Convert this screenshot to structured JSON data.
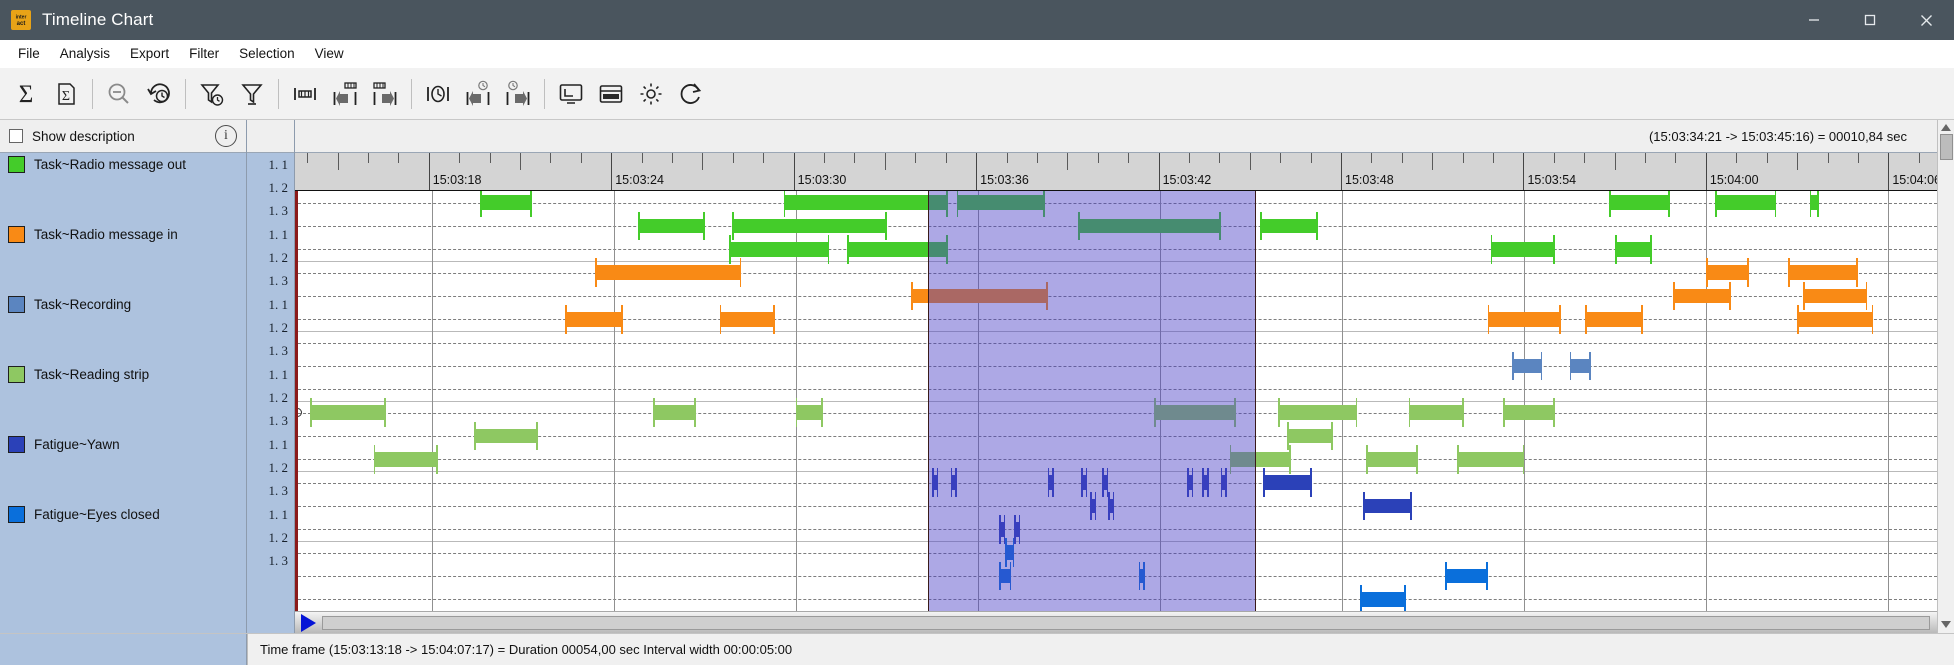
{
  "window": {
    "title": "Timeline Chart",
    "app_icon": "interact-logo-icon",
    "minimize_label": "—",
    "maximize_label": "□",
    "close_label": "✕"
  },
  "menubar": {
    "items": [
      {
        "label": "File",
        "name": "menu-file"
      },
      {
        "label": "Analysis",
        "name": "menu-analysis"
      },
      {
        "label": "Export",
        "name": "menu-export"
      },
      {
        "label": "Filter",
        "name": "menu-filter"
      },
      {
        "label": "Selection",
        "name": "menu-selection"
      },
      {
        "label": "View",
        "name": "menu-view"
      }
    ]
  },
  "toolbar": {
    "buttons": [
      {
        "name": "sum-button",
        "icon": "sigma-icon"
      },
      {
        "name": "sum-document-button",
        "icon": "sigma-document-icon"
      },
      {
        "name": "zoom-out-button",
        "icon": "magnifier-minus-icon"
      },
      {
        "name": "reset-zoom-history-button",
        "icon": "clock-undo-icon"
      },
      {
        "name": "filter-time-button",
        "icon": "funnel-clock-icon"
      },
      {
        "name": "filter-button",
        "icon": "funnel-icon"
      },
      {
        "name": "interval-width-button",
        "icon": "interval-span-icon"
      },
      {
        "name": "step-interval-back-button",
        "icon": "interval-step-left-icon"
      },
      {
        "name": "step-interval-forward-button",
        "icon": "interval-step-right-icon"
      },
      {
        "name": "time-span-button",
        "icon": "clock-span-icon"
      },
      {
        "name": "step-time-back-button",
        "icon": "clock-step-left-icon"
      },
      {
        "name": "step-time-forward-button",
        "icon": "clock-step-right-icon"
      },
      {
        "name": "fit-window-button",
        "icon": "screen-fit-icon"
      },
      {
        "name": "layout-rows-button",
        "icon": "rows-layout-icon"
      },
      {
        "name": "settings-button",
        "icon": "gear-icon"
      },
      {
        "name": "refresh-button",
        "icon": "refresh-icon"
      }
    ]
  },
  "sidebar": {
    "show_description_label": "Show description",
    "show_description_checked": false,
    "info_icon": "info-icon",
    "info_glyph": "i",
    "tracks": [
      {
        "label": "Task~Radio message out",
        "color": "#44cc2a",
        "name": "legend-task-radio-message-out"
      },
      {
        "label": "Task~Radio message in",
        "color": "#f98a15",
        "name": "legend-task-radio-message-in"
      },
      {
        "label": "Task~Recording",
        "color": "#5b85c0",
        "name": "legend-task-recording"
      },
      {
        "label": "Task~Reading strip",
        "color": "#8ec862",
        "name": "legend-task-reading-strip"
      },
      {
        "label": "Fatigue~Yawn",
        "color": "#2b41b8",
        "name": "legend-fatigue-yawn"
      },
      {
        "label": "Fatigue~Eyes closed",
        "color": "#0a6fdb",
        "name": "legend-fatigue-eyes-closed"
      }
    ],
    "row_numbers": [
      "1.  1",
      "1.  2",
      "1.  3",
      "1.  1",
      "1.  2",
      "1.  3",
      "1.  1",
      "1.  2",
      "1.  3",
      "1.  1",
      "1.  2",
      "1.  3",
      "1.  1",
      "1.  2",
      "1.  3",
      "1.  1",
      "1.  2",
      "1.  3"
    ]
  },
  "selection_info": {
    "text": "(15:03:34:21 -> 15:03:45:16) = 00010,84 sec"
  },
  "statusbar": {
    "text": "Time frame  (15:03:13:18 -> 15:04:07:17) = Duration 00054,00 sec   Interval width 00:00:05:00"
  },
  "scroll": {
    "play_icon": "play-triangle-icon",
    "up_arrow_icon": "scroll-up-arrow-icon",
    "down_arrow_icon": "scroll-down-arrow-icon"
  },
  "chart_data": {
    "type": "timeline",
    "title": "Timeline Chart",
    "xlabel": "",
    "ylabel": "",
    "time_start": "15:03:13:18",
    "time_end": "15:04:07:17",
    "duration_sec": 54.0,
    "interval_width": "00:00:05:00",
    "axis": {
      "t_min_sec": 13.6,
      "t_max_sec": 67.6,
      "tick_labels": [
        "15:03:18",
        "15:03:24",
        "15:03:30",
        "15:03:36",
        "15:03:42",
        "15:03:48",
        "15:03:54",
        "15:04:00",
        "15:04:06"
      ],
      "tick_seconds": [
        18,
        24,
        30,
        36,
        42,
        48,
        54,
        60,
        66
      ],
      "minor_tick_step_sec": 1,
      "grid": true
    },
    "selection": {
      "start_sec": 34.35,
      "end_sec": 45.16,
      "label": "(15:03:34:21 -> 15:03:45:16) = 00010,84 sec"
    },
    "marker_sec": 13.9,
    "tracks": [
      {
        "name": "Task~Radio message out",
        "color": "#44cc2a",
        "rows": [
          {
            "row": "1.  1",
            "bars": [
              {
                "start": 19.6,
                "end": 21.3
              },
              {
                "start": 29.6,
                "end": 35.0
              },
              {
                "start": 35.3,
                "end": 38.2
              },
              {
                "start": 56.8,
                "end": 58.8
              },
              {
                "start": 60.3,
                "end": 62.3
              },
              {
                "start": 63.4,
                "end": 63.7
              }
            ]
          },
          {
            "row": "1.  2",
            "bars": [
              {
                "start": 24.8,
                "end": 27.0
              },
              {
                "start": 27.9,
                "end": 33.0
              },
              {
                "start": 39.3,
                "end": 44.0
              },
              {
                "start": 45.3,
                "end": 47.2
              }
            ]
          },
          {
            "row": "1.  3",
            "bars": [
              {
                "start": 27.8,
                "end": 31.1
              },
              {
                "start": 31.7,
                "end": 35.0
              },
              {
                "start": 52.9,
                "end": 55.0
              },
              {
                "start": 57.0,
                "end": 58.2
              }
            ]
          }
        ]
      },
      {
        "name": "Task~Radio message in",
        "color": "#f98a15",
        "rows": [
          {
            "row": "1.  1",
            "bars": [
              {
                "start": 23.4,
                "end": 28.2
              },
              {
                "start": 60.0,
                "end": 61.4
              },
              {
                "start": 62.7,
                "end": 65.0
              }
            ]
          },
          {
            "row": "1.  2",
            "bars": [
              {
                "start": 33.8,
                "end": 38.3
              },
              {
                "start": 58.9,
                "end": 60.8
              },
              {
                "start": 63.2,
                "end": 65.3
              }
            ]
          },
          {
            "row": "1.  3",
            "bars": [
              {
                "start": 22.4,
                "end": 24.3
              },
              {
                "start": 27.5,
                "end": 29.3
              },
              {
                "start": 52.8,
                "end": 55.2
              },
              {
                "start": 56.0,
                "end": 57.9
              },
              {
                "start": 63.0,
                "end": 65.5
              }
            ]
          }
        ]
      },
      {
        "name": "Task~Recording",
        "color": "#5b85c0",
        "rows": [
          {
            "row": "1.  1",
            "bars": []
          },
          {
            "row": "1.  2",
            "bars": [
              {
                "start": 53.6,
                "end": 54.6
              },
              {
                "start": 55.5,
                "end": 56.2
              }
            ]
          },
          {
            "row": "1.  3",
            "bars": []
          }
        ]
      },
      {
        "name": "Task~Reading strip",
        "color": "#8ec862",
        "rows": [
          {
            "row": "1.  1",
            "bars": [
              {
                "start": 14.0,
                "end": 16.5
              },
              {
                "start": 25.3,
                "end": 26.7
              },
              {
                "start": 30.0,
                "end": 30.9
              },
              {
                "start": 41.8,
                "end": 44.5
              },
              {
                "start": 45.9,
                "end": 48.5
              },
              {
                "start": 50.2,
                "end": 52.0
              },
              {
                "start": 53.3,
                "end": 55.0
              }
            ]
          },
          {
            "row": "1.  2",
            "bars": [
              {
                "start": 19.4,
                "end": 21.5
              },
              {
                "start": 46.2,
                "end": 47.7
              }
            ]
          },
          {
            "row": "1.  3",
            "bars": [
              {
                "start": 16.1,
                "end": 18.2
              },
              {
                "start": 44.3,
                "end": 46.3
              },
              {
                "start": 48.8,
                "end": 50.5
              },
              {
                "start": 51.8,
                "end": 54.0
              }
            ]
          }
        ]
      },
      {
        "name": "Fatigue~Yawn",
        "color": "#2b41b8",
        "rows": [
          {
            "row": "1.  1",
            "bars": [
              {
                "start": 34.5,
                "end": 34.7
              },
              {
                "start": 35.1,
                "end": 35.3
              },
              {
                "start": 38.3,
                "end": 38.5
              },
              {
                "start": 39.4,
                "end": 39.6
              },
              {
                "start": 40.1,
                "end": 40.3
              },
              {
                "start": 42.9,
                "end": 43.1
              },
              {
                "start": 43.4,
                "end": 43.6
              },
              {
                "start": 44.0,
                "end": 44.2
              },
              {
                "start": 45.4,
                "end": 47.0
              }
            ]
          },
          {
            "row": "1.  2",
            "bars": [
              {
                "start": 39.7,
                "end": 39.9
              },
              {
                "start": 40.3,
                "end": 40.5
              },
              {
                "start": 48.7,
                "end": 50.3
              }
            ]
          },
          {
            "row": "1.  3",
            "bars": [
              {
                "start": 36.7,
                "end": 36.9
              },
              {
                "start": 37.2,
                "end": 37.4
              }
            ]
          }
        ]
      },
      {
        "name": "Fatigue~Eyes closed",
        "color": "#0a6fdb",
        "rows": [
          {
            "row": "1.  1",
            "bars": [
              {
                "start": 36.9,
                "end": 37.2
              }
            ]
          },
          {
            "row": "1.  2",
            "bars": [
              {
                "start": 36.7,
                "end": 37.1
              },
              {
                "start": 41.3,
                "end": 41.5
              },
              {
                "start": 51.4,
                "end": 52.8
              }
            ]
          },
          {
            "row": "1.  3",
            "bars": [
              {
                "start": 48.6,
                "end": 50.1
              }
            ]
          }
        ]
      }
    ]
  }
}
